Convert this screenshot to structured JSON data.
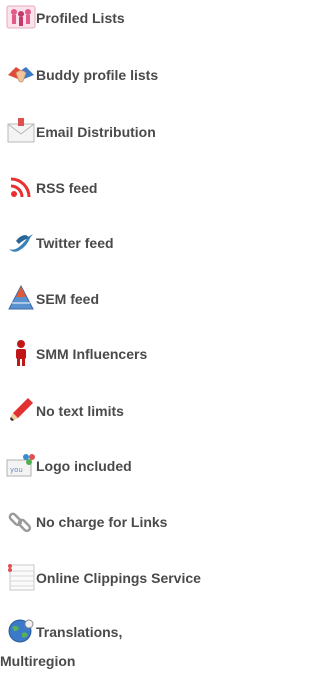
{
  "features": {
    "items": [
      {
        "label": "Profiled Lists",
        "icon": "profiled-lists-icon"
      },
      {
        "label": "Buddy profile lists",
        "icon": "buddy-lists-icon"
      },
      {
        "label": "Email Distribution",
        "icon": "email-icon"
      },
      {
        "label": "RSS feed",
        "icon": "rss-icon"
      },
      {
        "label": "Twitter feed",
        "icon": "twitter-bird-icon"
      },
      {
        "label": "SEM feed",
        "icon": "sem-pyramid-icon"
      },
      {
        "label": "SMM Influencers",
        "icon": "person-icon"
      },
      {
        "label": "No text limits",
        "icon": "pencil-icon"
      },
      {
        "label": "Logo included",
        "icon": "logo-icon"
      },
      {
        "label": "No charge for Links",
        "icon": "link-icon"
      },
      {
        "label": "Online Clippings Service",
        "icon": "clipping-notepad-icon"
      },
      {
        "label": "Translations,",
        "label_line2": "Multiregion",
        "icon": "globe-translation-icon"
      }
    ]
  },
  "colors": {
    "text": "#4a4a4a",
    "background": "#ffffff"
  }
}
